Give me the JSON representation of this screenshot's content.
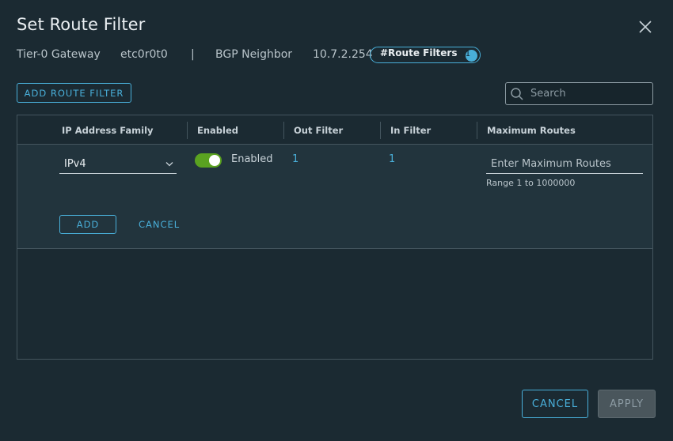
{
  "dialog": {
    "title": "Set Route Filter",
    "subheader": {
      "gateway_label": "Tier-0 Gateway",
      "gateway_id": "etc0r0t0",
      "separator": "|",
      "neighbor_label": "BGP Neighbor",
      "neighbor_ip": "10.7.2.254",
      "badge_label": "#Route Filters",
      "badge_count": "1"
    },
    "toolbar": {
      "add_route_filter_label": "ADD ROUTE FILTER",
      "search_placeholder": "Search"
    },
    "grid": {
      "columns": [
        "IP Address Family",
        "Enabled",
        "Out Filter",
        "In Filter",
        "Maximum Routes"
      ],
      "edit_row": {
        "ip_family_value": "IPv4",
        "enabled_state": "on",
        "enabled_label": "Enabled",
        "out_filter_count": "1",
        "in_filter_count": "1",
        "max_routes_placeholder": "Enter Maximum Routes",
        "max_routes_hint": "Range 1 to 1000000",
        "add_label": "ADD",
        "cancel_label": "CANCEL"
      }
    },
    "footer": {
      "cancel_label": "CANCEL",
      "apply_label": "APPLY"
    }
  },
  "colors": {
    "background": "#1b2a32",
    "accent": "#49afd9",
    "toggle_on": "#5aa220",
    "edit_row": "#22343d"
  },
  "icons": [
    "close-icon",
    "search-icon",
    "chevron-down-icon"
  ]
}
